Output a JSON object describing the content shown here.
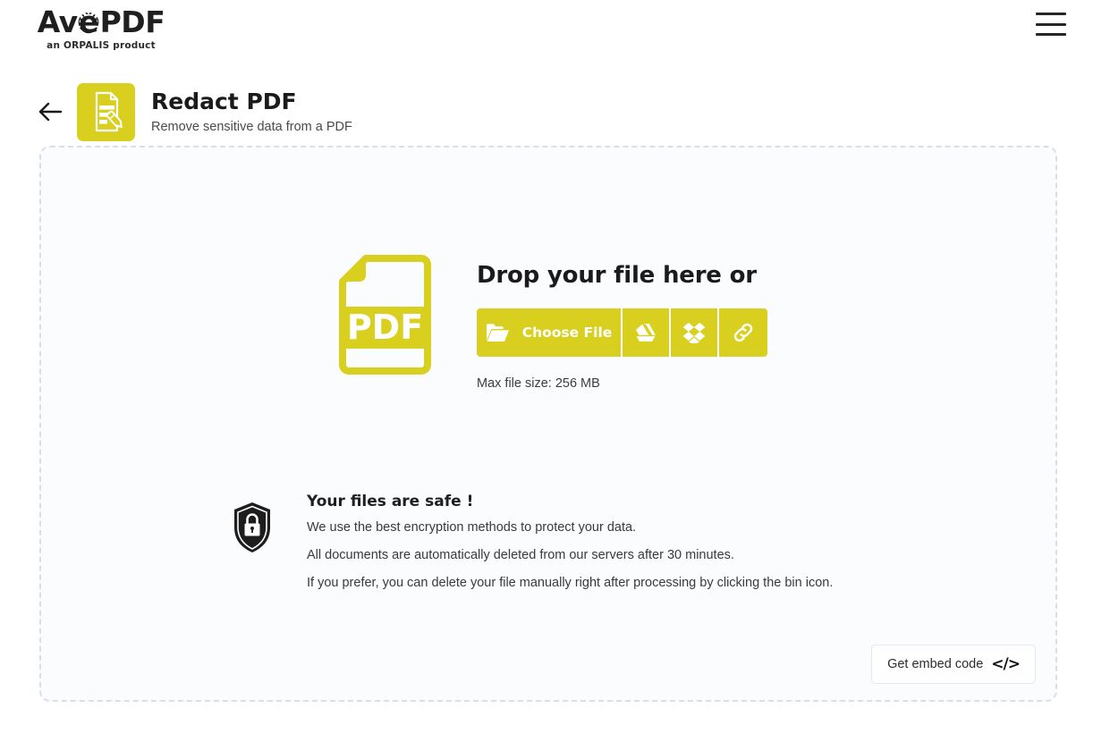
{
  "colors": {
    "brand_yellow": "#D8CF1E",
    "dropzone_border": "#d7e0ea",
    "dropzone_bg": "#fbfcfe",
    "text_dark": "#1b1b1b"
  },
  "header": {
    "logo_part1": "Av",
    "logo_e": "e",
    "logo_part2": "PDF",
    "tagline": "an ORPALIS product",
    "menu_icon": "hamburger-menu-icon"
  },
  "tool": {
    "back_icon": "arrow-left-icon",
    "icon": "redact-document-icon",
    "title": "Redact PDF",
    "subtitle": "Remove sensitive data from a PDF"
  },
  "dropzone": {
    "file_icon": "pdf-file-icon",
    "file_icon_label": "PDF",
    "title": "Drop your file here or",
    "buttons": {
      "choose_file": "Choose File",
      "choose_file_icon": "folder-open-icon",
      "google_drive_icon": "google-drive-icon",
      "dropbox_icon": "dropbox-icon",
      "url_link_icon": "link-icon"
    },
    "max_file_size": "Max file size: 256 MB"
  },
  "safety": {
    "icon": "shield-lock-icon",
    "title": "Your files are safe !",
    "lines": [
      "We use the best encryption methods to protect your data.",
      "All documents are automatically deleted from our servers after 30 minutes.",
      "If you prefer, you can delete your file manually right after processing by clicking the bin icon."
    ]
  },
  "embed": {
    "label": "Get embed code",
    "glyph": "</>"
  }
}
